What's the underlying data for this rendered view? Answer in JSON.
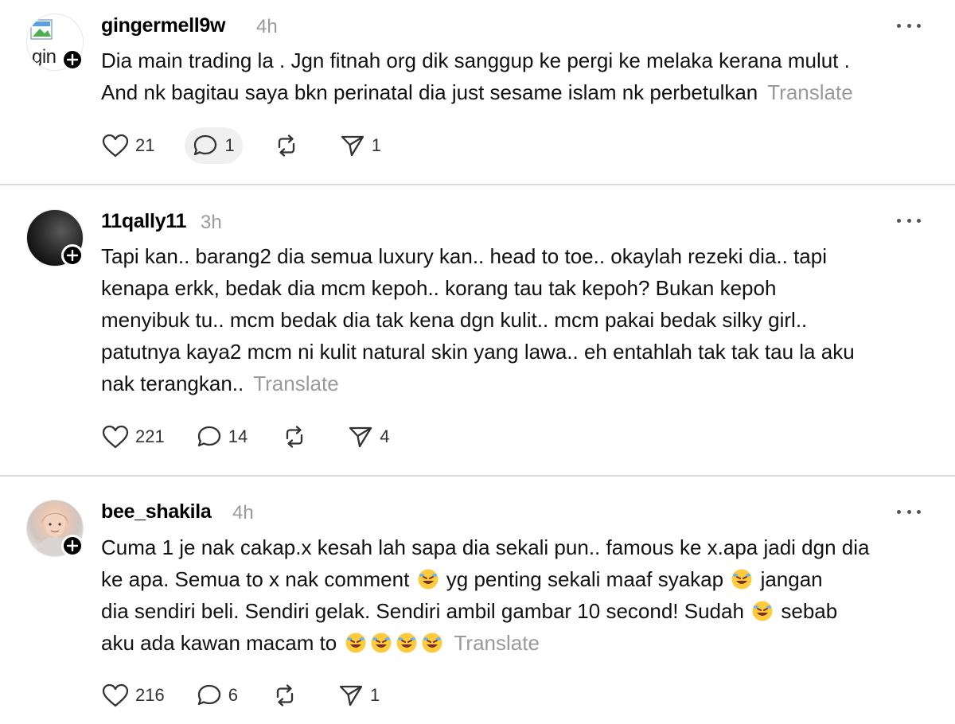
{
  "posts": [
    {
      "username": "gingermell9w",
      "time": "4h",
      "avatar_alt": "gin",
      "lines": [
        "Dia main trading la . Jgn fitnah org dik sanggup ke pergi ke melaka kerana mulut .",
        "And nk bagitau saya bkn perinatal dia just sesame islam nk perbetulkan"
      ],
      "translate": "Translate",
      "likes": "21",
      "replies": "1",
      "shares": "1"
    },
    {
      "username": "11qally11",
      "time": "3h",
      "lines": [
        "Tapi kan.. barang2 dia semua luxury kan.. head to toe.. okaylah rezeki dia.. tapi",
        "kenapa erkk, bedak dia mcm kepoh.. korang tau tak kepoh? Bukan kepoh",
        "menyibuk tu.. mcm bedak dia tak kena dgn kulit.. mcm pakai bedak silky girl..",
        "patutnya kaya2 mcm ni kulit natural skin yang lawa.. eh entahlah tak tak tau la aku",
        "nak terangkan.."
      ],
      "translate": "Translate",
      "likes": "221",
      "replies": "14",
      "shares": "4"
    },
    {
      "username": "bee_shakila",
      "time": "4h",
      "lines": [
        "Cuma 1 je nak cakap.x kesah lah sapa dia sekali pun.. famous ke x.apa jadi dgn dia",
        "ke apa. Semua to x nak comment",
        "yg penting sekali maaf syakap",
        "jangan",
        "dia sendiri beli. Sendiri gelak. Sendiri ambil gambar 10 second! Sudah",
        "sebab",
        "aku ada kawan macam to"
      ],
      "translate": "Translate",
      "likes": "216",
      "replies": "6",
      "shares": "1"
    }
  ],
  "icons": {
    "like": "heart-icon",
    "reply": "speech-bubble-icon",
    "repost": "repost-icon",
    "share": "send-icon",
    "more": "more-icon",
    "follow": "plus-icon",
    "emoji": "rolling-on-floor-laughing-emoji"
  },
  "colors": {
    "text": "#111111",
    "muted": "#9a9a9a",
    "divider": "#dcdcdc",
    "badge": "#000000"
  }
}
